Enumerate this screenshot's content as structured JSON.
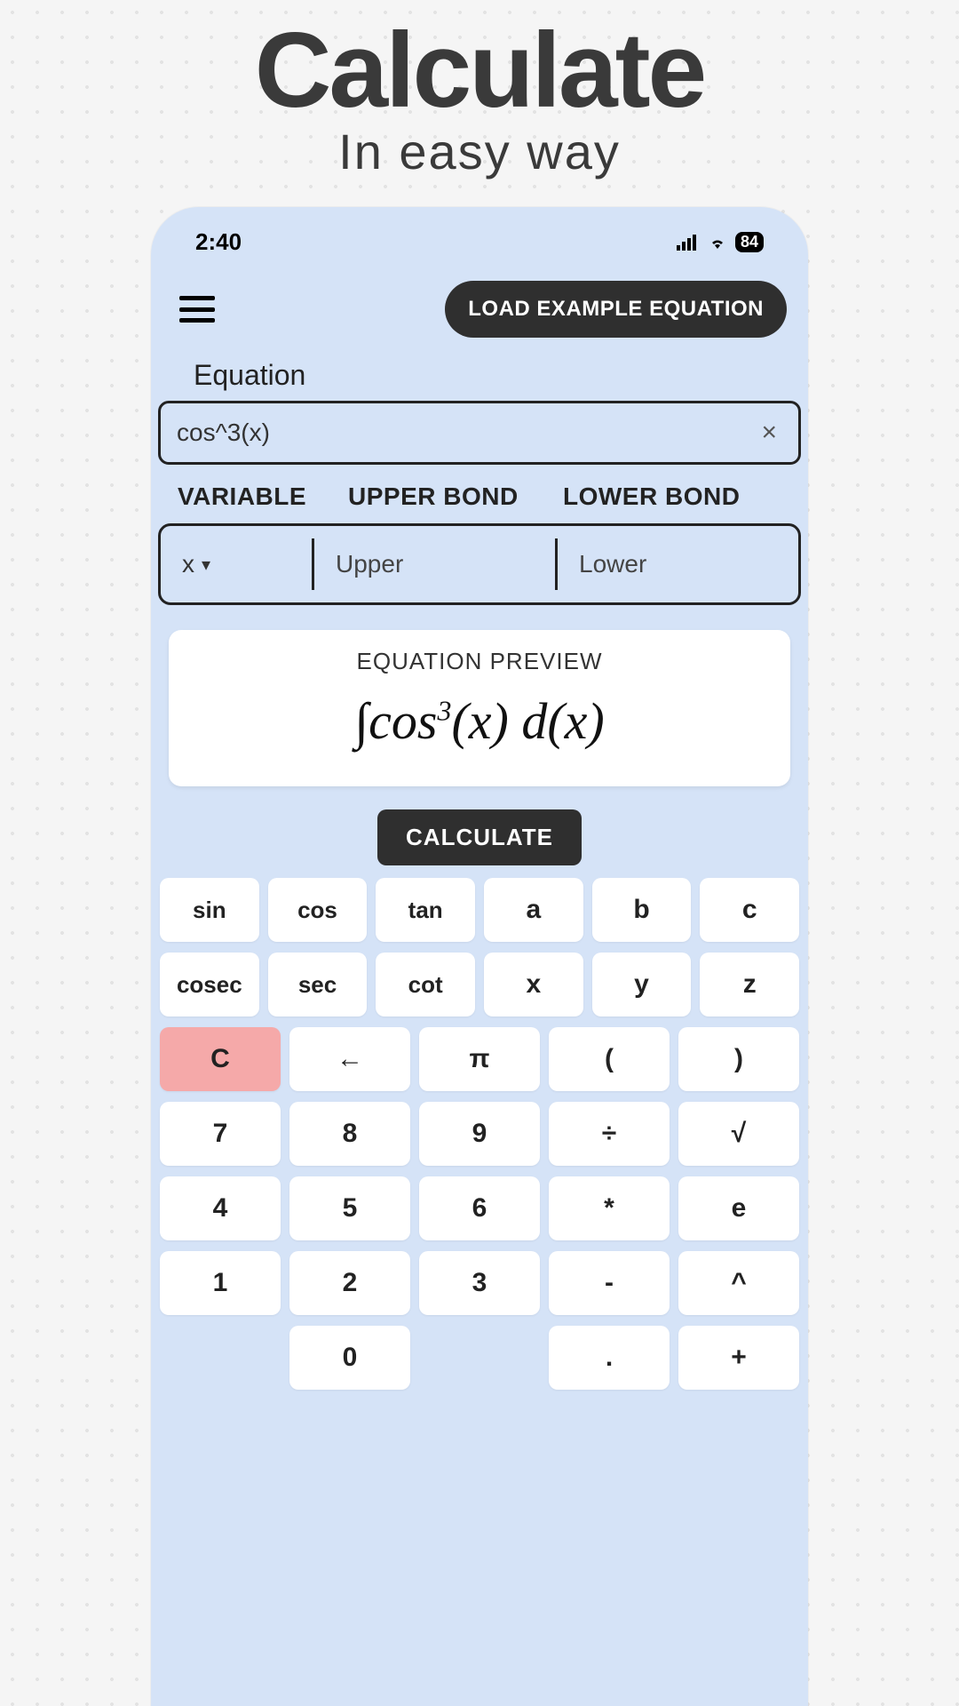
{
  "hero": {
    "title": "Calculate",
    "subtitle": "In easy way"
  },
  "status": {
    "time": "2:40",
    "battery": "84"
  },
  "toolbar": {
    "load_label": "LOAD EXAMPLE EQUATION"
  },
  "equation": {
    "label": "Equation",
    "value": "cos^3(x)",
    "clear_icon": "×"
  },
  "bonds": {
    "labels": {
      "variable": "VARIABLE",
      "upper": "UPPER BOND",
      "lower": "LOWER BOND"
    },
    "variable": "x",
    "upper_placeholder": "Upper",
    "lower_placeholder": "Lower"
  },
  "preview": {
    "label": "EQUATION PREVIEW",
    "integral": "∫",
    "expr_prefix": "cos",
    "expr_sup": "3",
    "expr_suffix": "(x) d(x)"
  },
  "calculate_label": "CALCULATE",
  "keys": {
    "r1": [
      "sin",
      "cos",
      "tan",
      "a",
      "b",
      "c"
    ],
    "r2": [
      "cosec",
      "sec",
      "cot",
      "x",
      "y",
      "z"
    ],
    "r3": [
      "C",
      "←",
      "π",
      "(",
      ")"
    ],
    "r4": [
      "7",
      "8",
      "9",
      "÷",
      "√"
    ],
    "r5": [
      "4",
      "5",
      "6",
      "*",
      "e"
    ],
    "r6": [
      "1",
      "2",
      "3",
      "-",
      "^"
    ],
    "r7": [
      "",
      "0",
      "",
      ".",
      "+"
    ]
  }
}
